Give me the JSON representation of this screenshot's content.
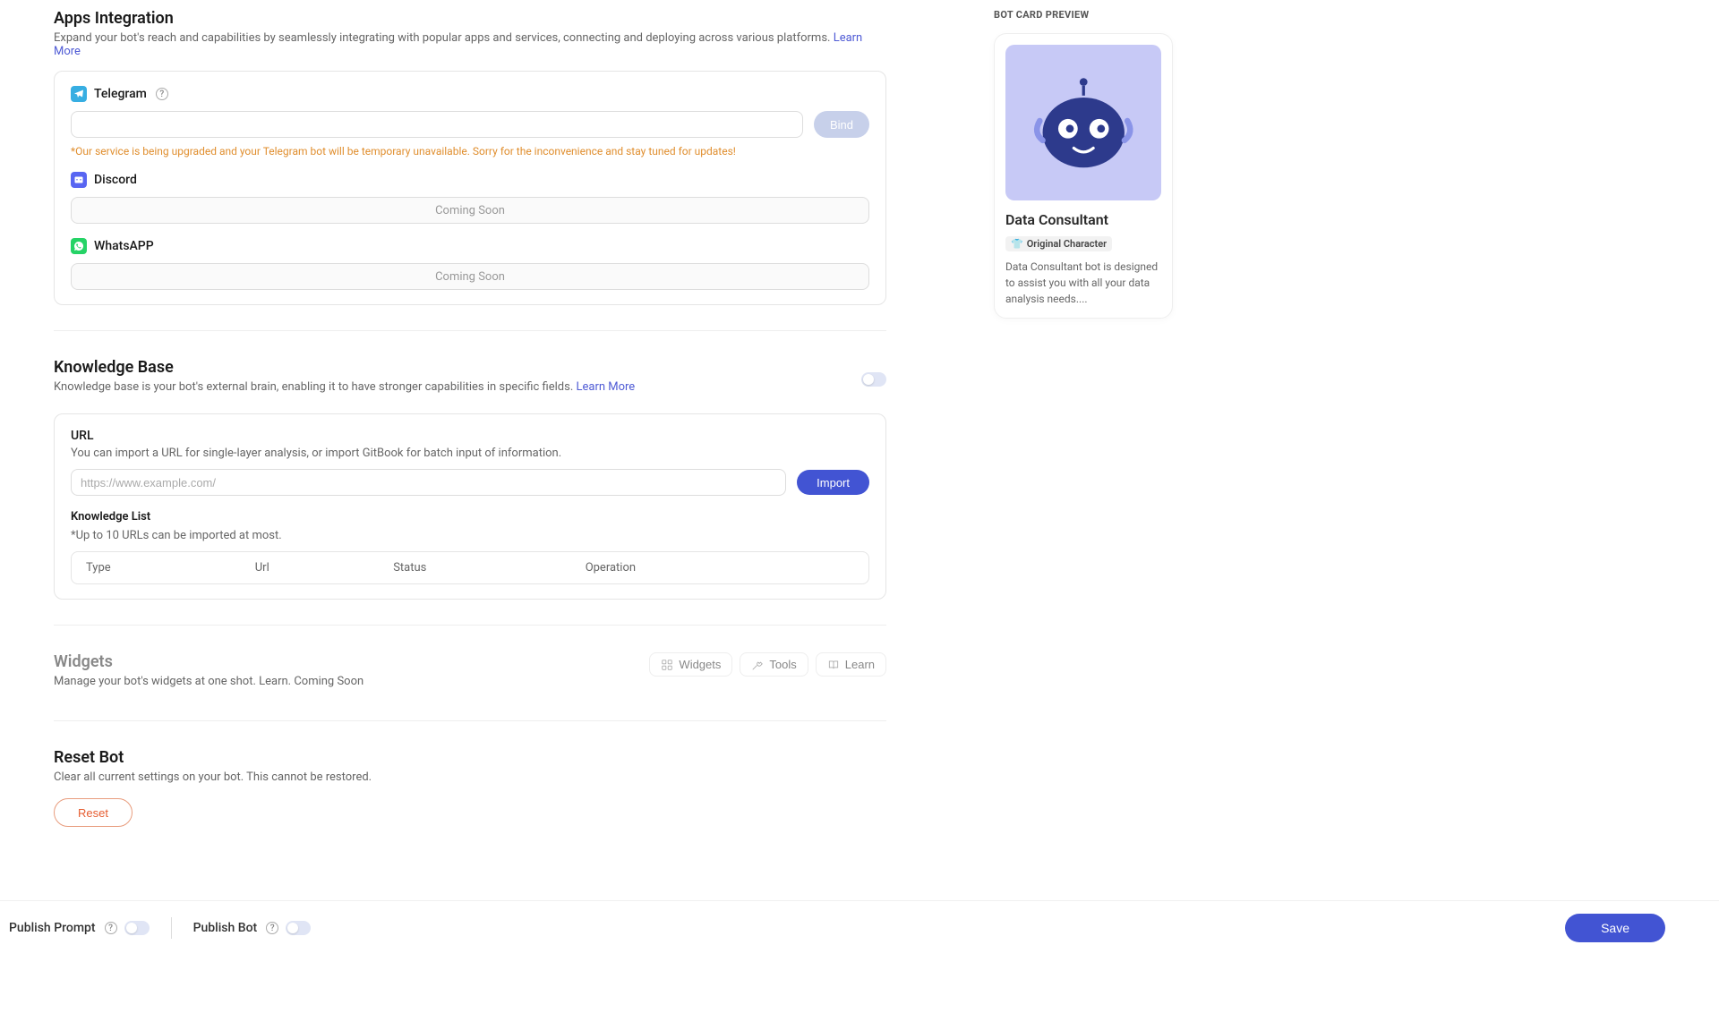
{
  "apps_integration": {
    "title": "Apps Integration",
    "desc": "Expand your bot's reach and capabilities by seamlessly integrating with popular apps and services, connecting and deploying across various platforms. ",
    "learn_more": "Learn More",
    "telegram": {
      "label": "Telegram",
      "bind_btn": "Bind",
      "warning": "*Our service is being upgraded and your Telegram bot will be temporary unavailable. Sorry for the inconvenience and stay tuned for updates!"
    },
    "discord": {
      "label": "Discord",
      "status": "Coming Soon"
    },
    "whatsapp": {
      "label": "WhatsAPP",
      "status": "Coming Soon"
    }
  },
  "knowledge_base": {
    "title": "Knowledge Base",
    "desc": "Knowledge base is your bot's external brain, enabling it to have stronger capabilities in specific fields. ",
    "learn_more": "Learn More",
    "url_section": {
      "title": "URL",
      "desc": "You can import a URL for single-layer analysis, or import GitBook for batch input of information.",
      "placeholder": "https://www.example.com/",
      "import_btn": "Import"
    },
    "list_section": {
      "title": "Knowledge List",
      "note": "*Up to 10 URLs can be imported at most.",
      "columns": {
        "type": "Type",
        "url": "Url",
        "status": "Status",
        "operation": "Operation"
      }
    }
  },
  "widgets": {
    "title": "Widgets",
    "desc": "Manage your bot's widgets at one shot. Learn. Coming Soon",
    "buttons": {
      "widgets": "Widgets",
      "tools": "Tools",
      "learn": "Learn"
    }
  },
  "reset": {
    "title": "Reset Bot",
    "desc": "Clear all current settings on your bot. This cannot be restored.",
    "btn": "Reset"
  },
  "preview": {
    "label": "BOT CARD PREVIEW",
    "name": "Data Consultant",
    "badge": "Original Character",
    "desc": "Data Consultant bot is designed to assist you with all your data analysis needs...."
  },
  "bottom": {
    "publish_prompt": "Publish Prompt",
    "publish_bot": "Publish Bot",
    "save": "Save"
  }
}
